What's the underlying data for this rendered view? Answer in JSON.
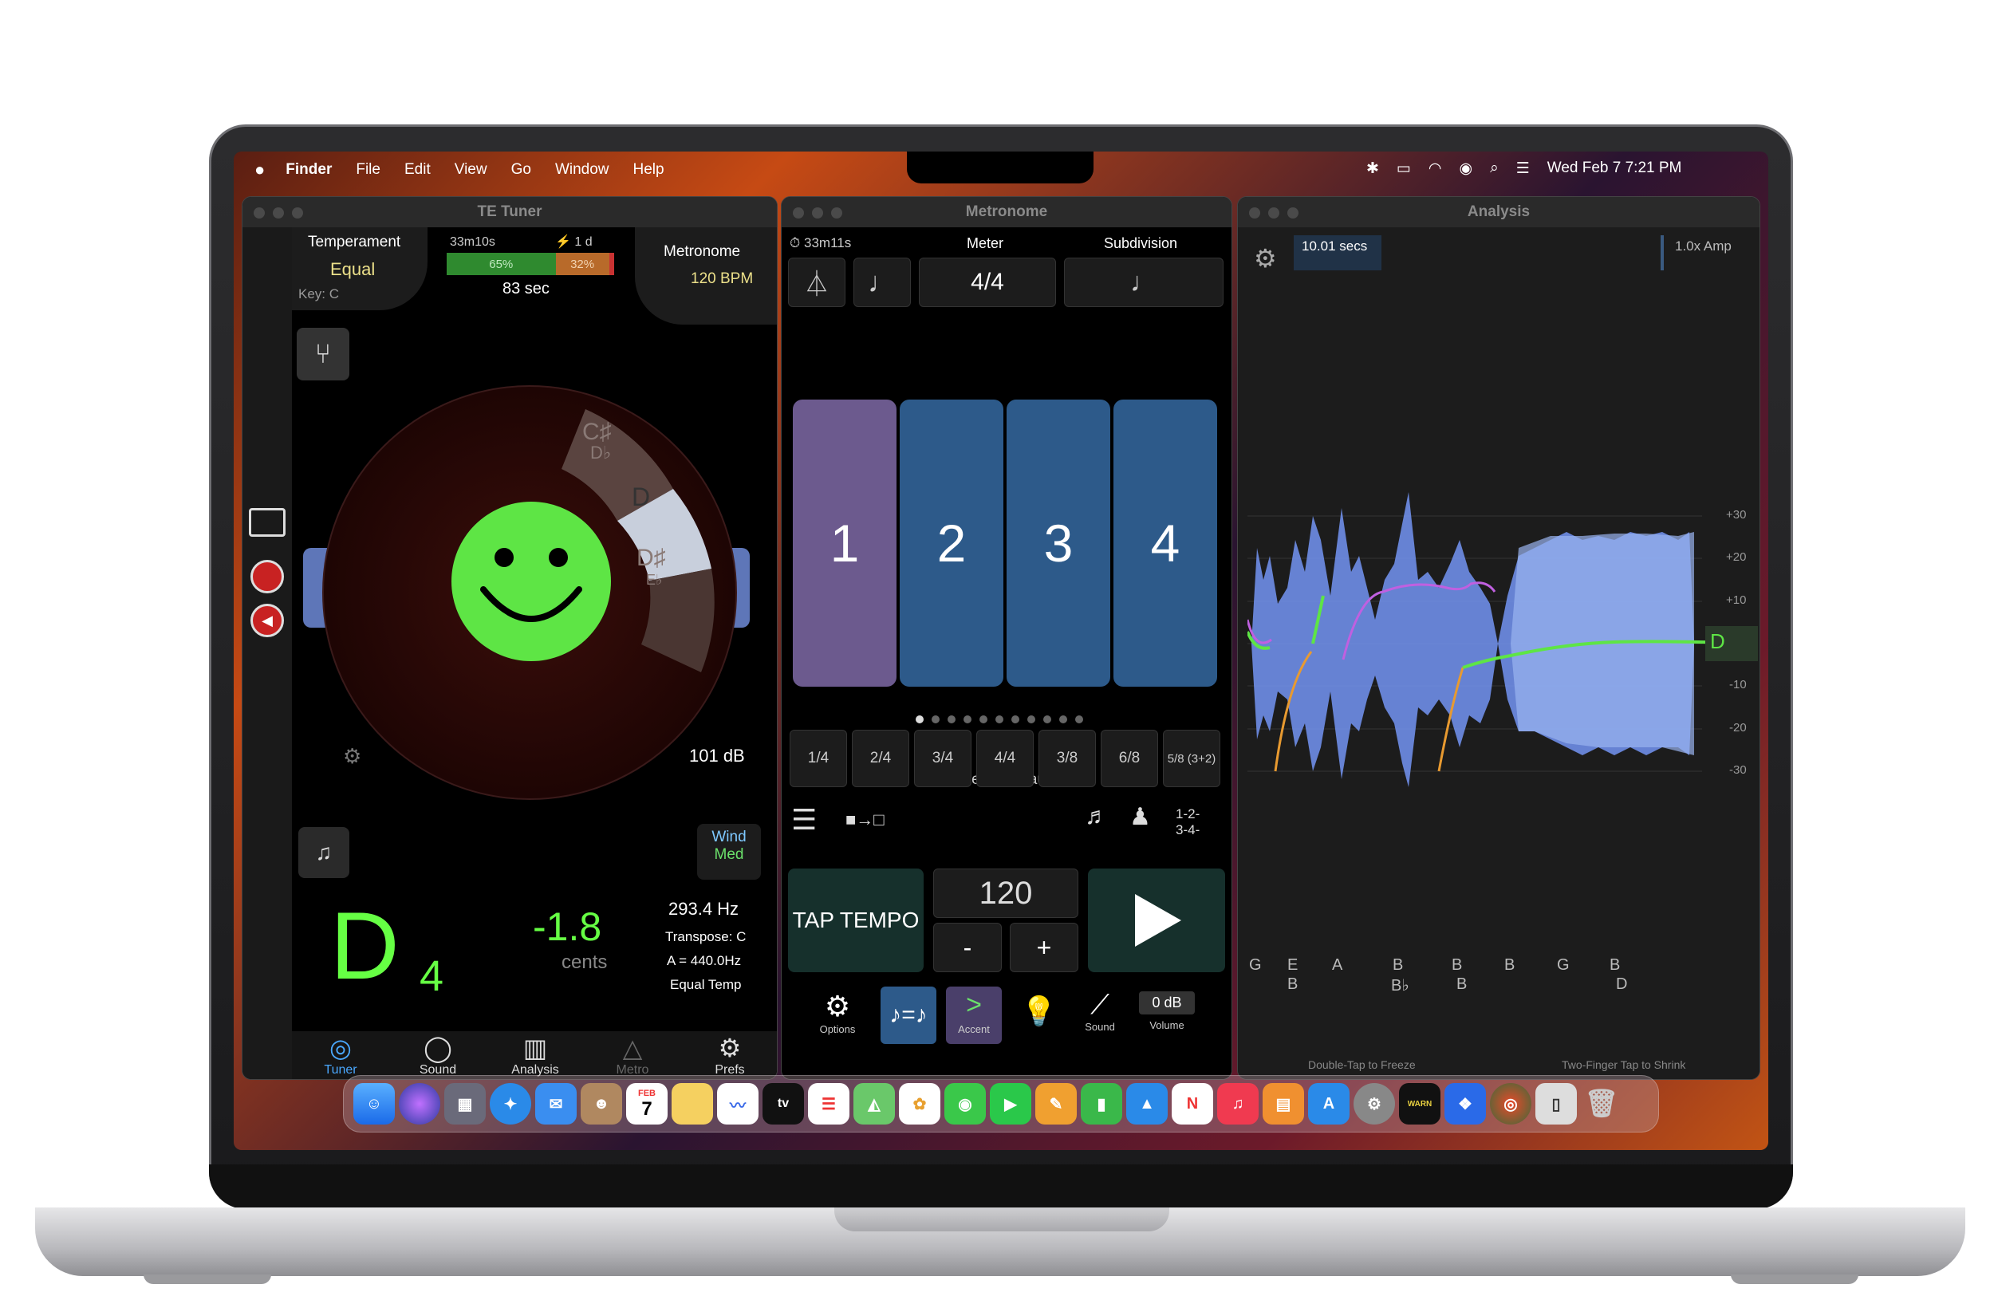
{
  "menubar": {
    "app": "Finder",
    "items": [
      "File",
      "Edit",
      "View",
      "Go",
      "Window",
      "Help"
    ],
    "clock": "Wed Feb 7  7:21 PM"
  },
  "tuner": {
    "title": "TE Tuner",
    "temperament_label": "Temperament",
    "temperament_value": "Equal",
    "key": "Key: C",
    "timer": "33m10s",
    "duration": "1 d",
    "bar_green": "65%",
    "bar_orange": "32%",
    "bar_green_fraction": 0.65,
    "bar_orange_fraction": 0.32,
    "secs": "83 sec",
    "metronome_label": "Metronome",
    "bpm": "120 BPM",
    "wheel_notes": {
      "csharp": "C♯",
      "dflat": "D♭",
      "d": "D",
      "dsharp": "D♯",
      "eflat": "E♭"
    },
    "db": "101 dB",
    "wind": "Wind",
    "med": "Med",
    "note": "D",
    "octave": "4",
    "cents_value": "-1.8",
    "cents_label": "cents",
    "hz": "293.4 Hz",
    "transpose": "Transpose: C",
    "a_ref": "A = 440.0Hz",
    "temp": "Equal Temp",
    "tabs": [
      "Tuner",
      "Sound",
      "Analysis",
      "Metro",
      "Prefs"
    ],
    "colors": {
      "accent": "#5ee545",
      "note": "#66ff44"
    }
  },
  "metronome": {
    "title": "Metronome",
    "timer": "33m11s",
    "meter_label": "Meter",
    "subdivision_label": "Subdivision",
    "meter_value": "4/4",
    "beats": [
      "1",
      "2",
      "3",
      "4"
    ],
    "presets_label": "Presets - Default : 1",
    "presets": [
      "1/4",
      "2/4",
      "3/4",
      "4/4",
      "3/8",
      "6/8",
      "5/8 (3+2)"
    ],
    "count_label": "1-2-\n3-4-",
    "tap": "TAP TEMPO",
    "tempo": "120",
    "minus": "-",
    "plus": "+",
    "tools": {
      "options": "Options",
      "accent": "Accent",
      "sound": "Sound",
      "volume": "Volume",
      "volume_value": "0 dB"
    },
    "colors": {
      "beat1": "#6c5a8e",
      "beat": "#2d5a8a"
    }
  },
  "analysis": {
    "title": "Analysis",
    "secs": "10.01 secs",
    "amp": "1.0x Amp",
    "scale": [
      "+30",
      "+20",
      "+10",
      "D",
      "-10",
      "-20",
      "-30"
    ],
    "notes_top": [
      "G",
      "E",
      "A",
      "B",
      "B",
      "B",
      "G",
      "B"
    ],
    "notes_bottom": [
      "B",
      "B♭",
      "B",
      "D"
    ],
    "hint_left": "Double-Tap to Freeze",
    "hint_right": "Two-Finger Tap to Shrink"
  },
  "dock": {
    "calendar_month": "FEB",
    "calendar_day": "7",
    "tv": "tv",
    "widget": "WARN"
  }
}
